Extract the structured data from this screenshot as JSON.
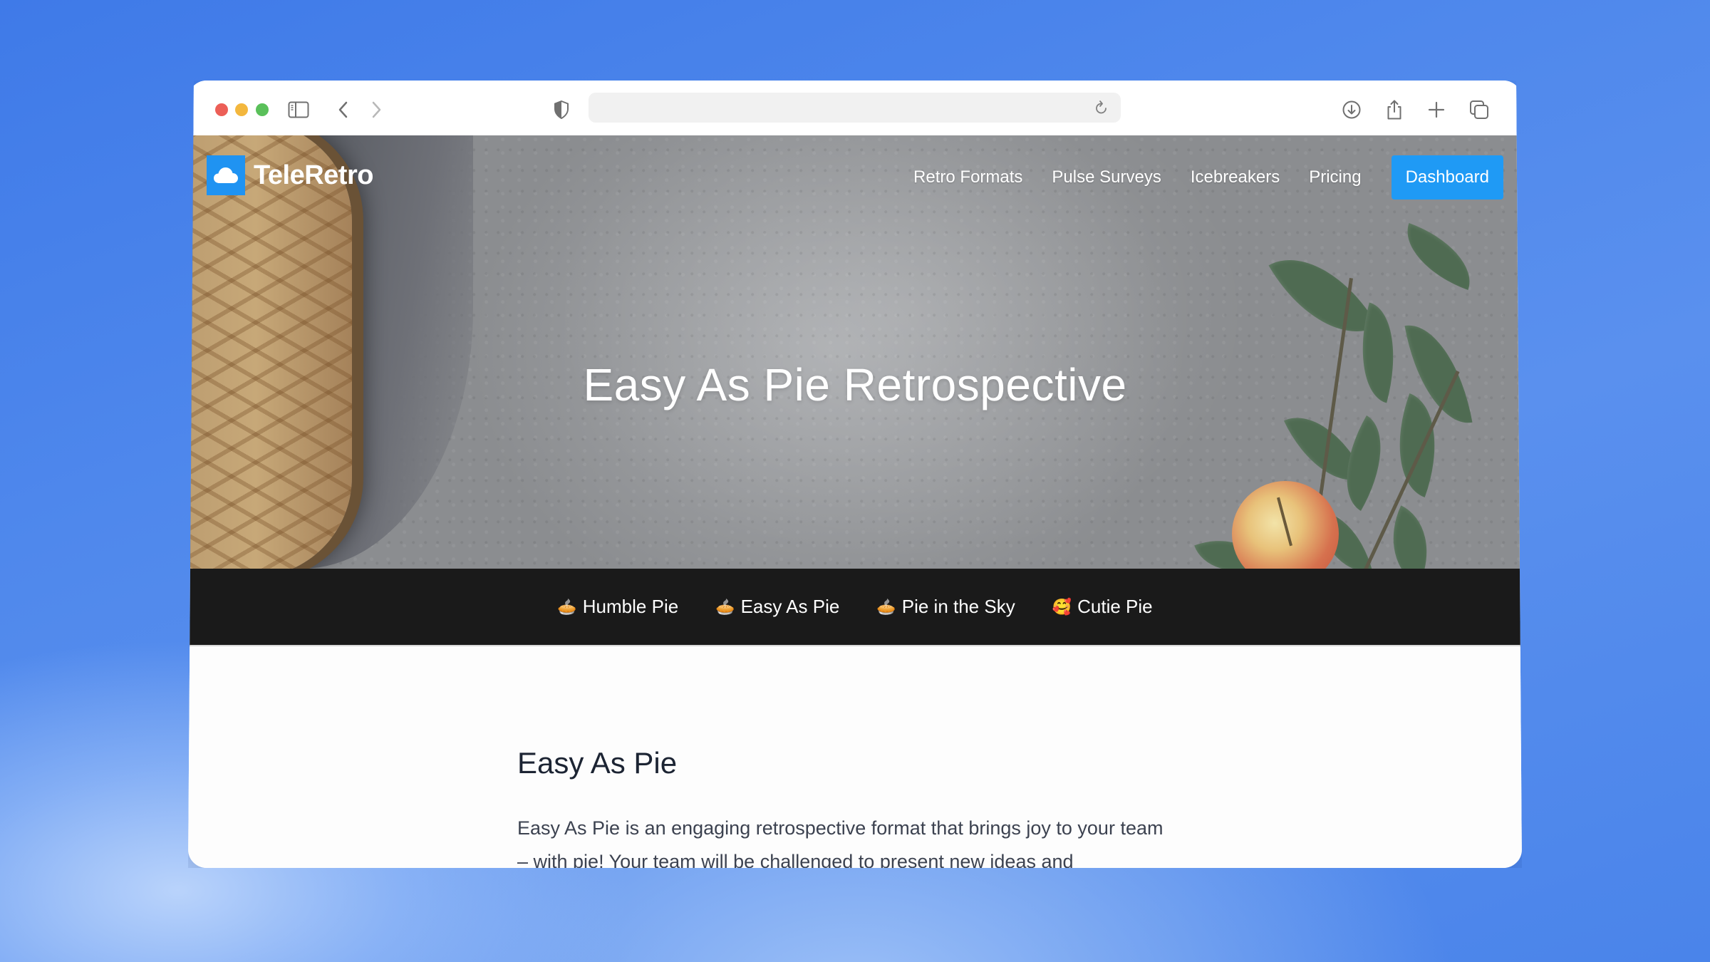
{
  "browser": {
    "address_value": "",
    "icons": {
      "sidebar": "sidebar-toggle-icon",
      "back": "chevron-left-icon",
      "forward": "chevron-right-icon",
      "privacy": "shield-icon",
      "reload": "reload-icon",
      "download": "download-icon",
      "share": "share-icon",
      "new_tab": "plus-icon",
      "tabs": "tabs-overview-icon"
    }
  },
  "site": {
    "brand": "TeleRetro",
    "brand_color": "#1f93f2",
    "nav": [
      {
        "label": "Retro Formats"
      },
      {
        "label": "Pulse Surveys"
      },
      {
        "label": "Icebreakers"
      },
      {
        "label": "Pricing"
      }
    ],
    "cta_label": "Dashboard",
    "cta_color": "#1f9af5"
  },
  "hero": {
    "title": "Easy As Pie Retrospective"
  },
  "categories": [
    {
      "emoji": "🥧",
      "label": "Humble Pie"
    },
    {
      "emoji": "🥧",
      "label": "Easy As Pie"
    },
    {
      "emoji": "🥧",
      "label": "Pie in the Sky"
    },
    {
      "emoji": "🥰",
      "label": "Cutie Pie"
    }
  ],
  "content": {
    "heading": "Easy As Pie",
    "paragraph": "Easy As Pie is an engaging retrospective format that brings joy to your team – with pie! Your team will be challenged to present new ideas and"
  }
}
